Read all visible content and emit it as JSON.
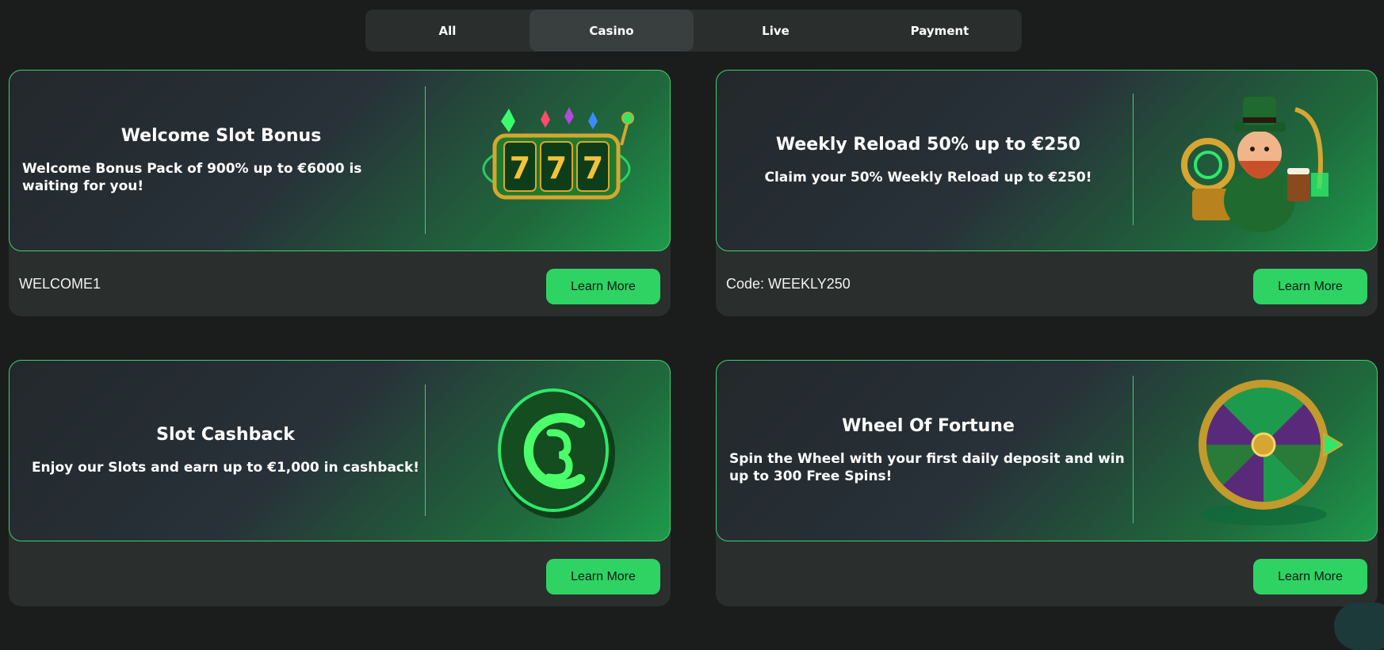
{
  "tabs": [
    {
      "label": "All",
      "active": false
    },
    {
      "label": "Casino",
      "active": true
    },
    {
      "label": "Live",
      "active": false
    },
    {
      "label": "Payment",
      "active": false
    }
  ],
  "promotions": [
    {
      "title": "Welcome Slot Bonus",
      "description": "Welcome Bonus Pack of 900% up to €6000 is waiting for you!",
      "code": "WELCOME1",
      "button": "Learn More",
      "icon": "slot-reels-777-icon"
    },
    {
      "title": "Weekly Reload 50% up to €250",
      "description": "Claim your 50% Weekly Reload up to €250!",
      "code": "Code: WEEKLY250",
      "button": "Learn More",
      "icon": "leprechaun-icon"
    },
    {
      "title": "Slot Cashback",
      "description": "Enjoy our Slots and earn up to €1,000 in cashback!",
      "code": "",
      "button": "Learn More",
      "icon": "cashback-coin-icon"
    },
    {
      "title": "Wheel Of Fortune",
      "description": "Spin the Wheel with your first daily deposit and win up to 300 Free Spins!",
      "code": "",
      "button": "Learn More",
      "icon": "fortune-wheel-icon"
    }
  ],
  "colors": {
    "background": "#1b1d1c",
    "card": "#2a2e2d",
    "accent": "#2ed364",
    "border": "#3ed06d"
  }
}
